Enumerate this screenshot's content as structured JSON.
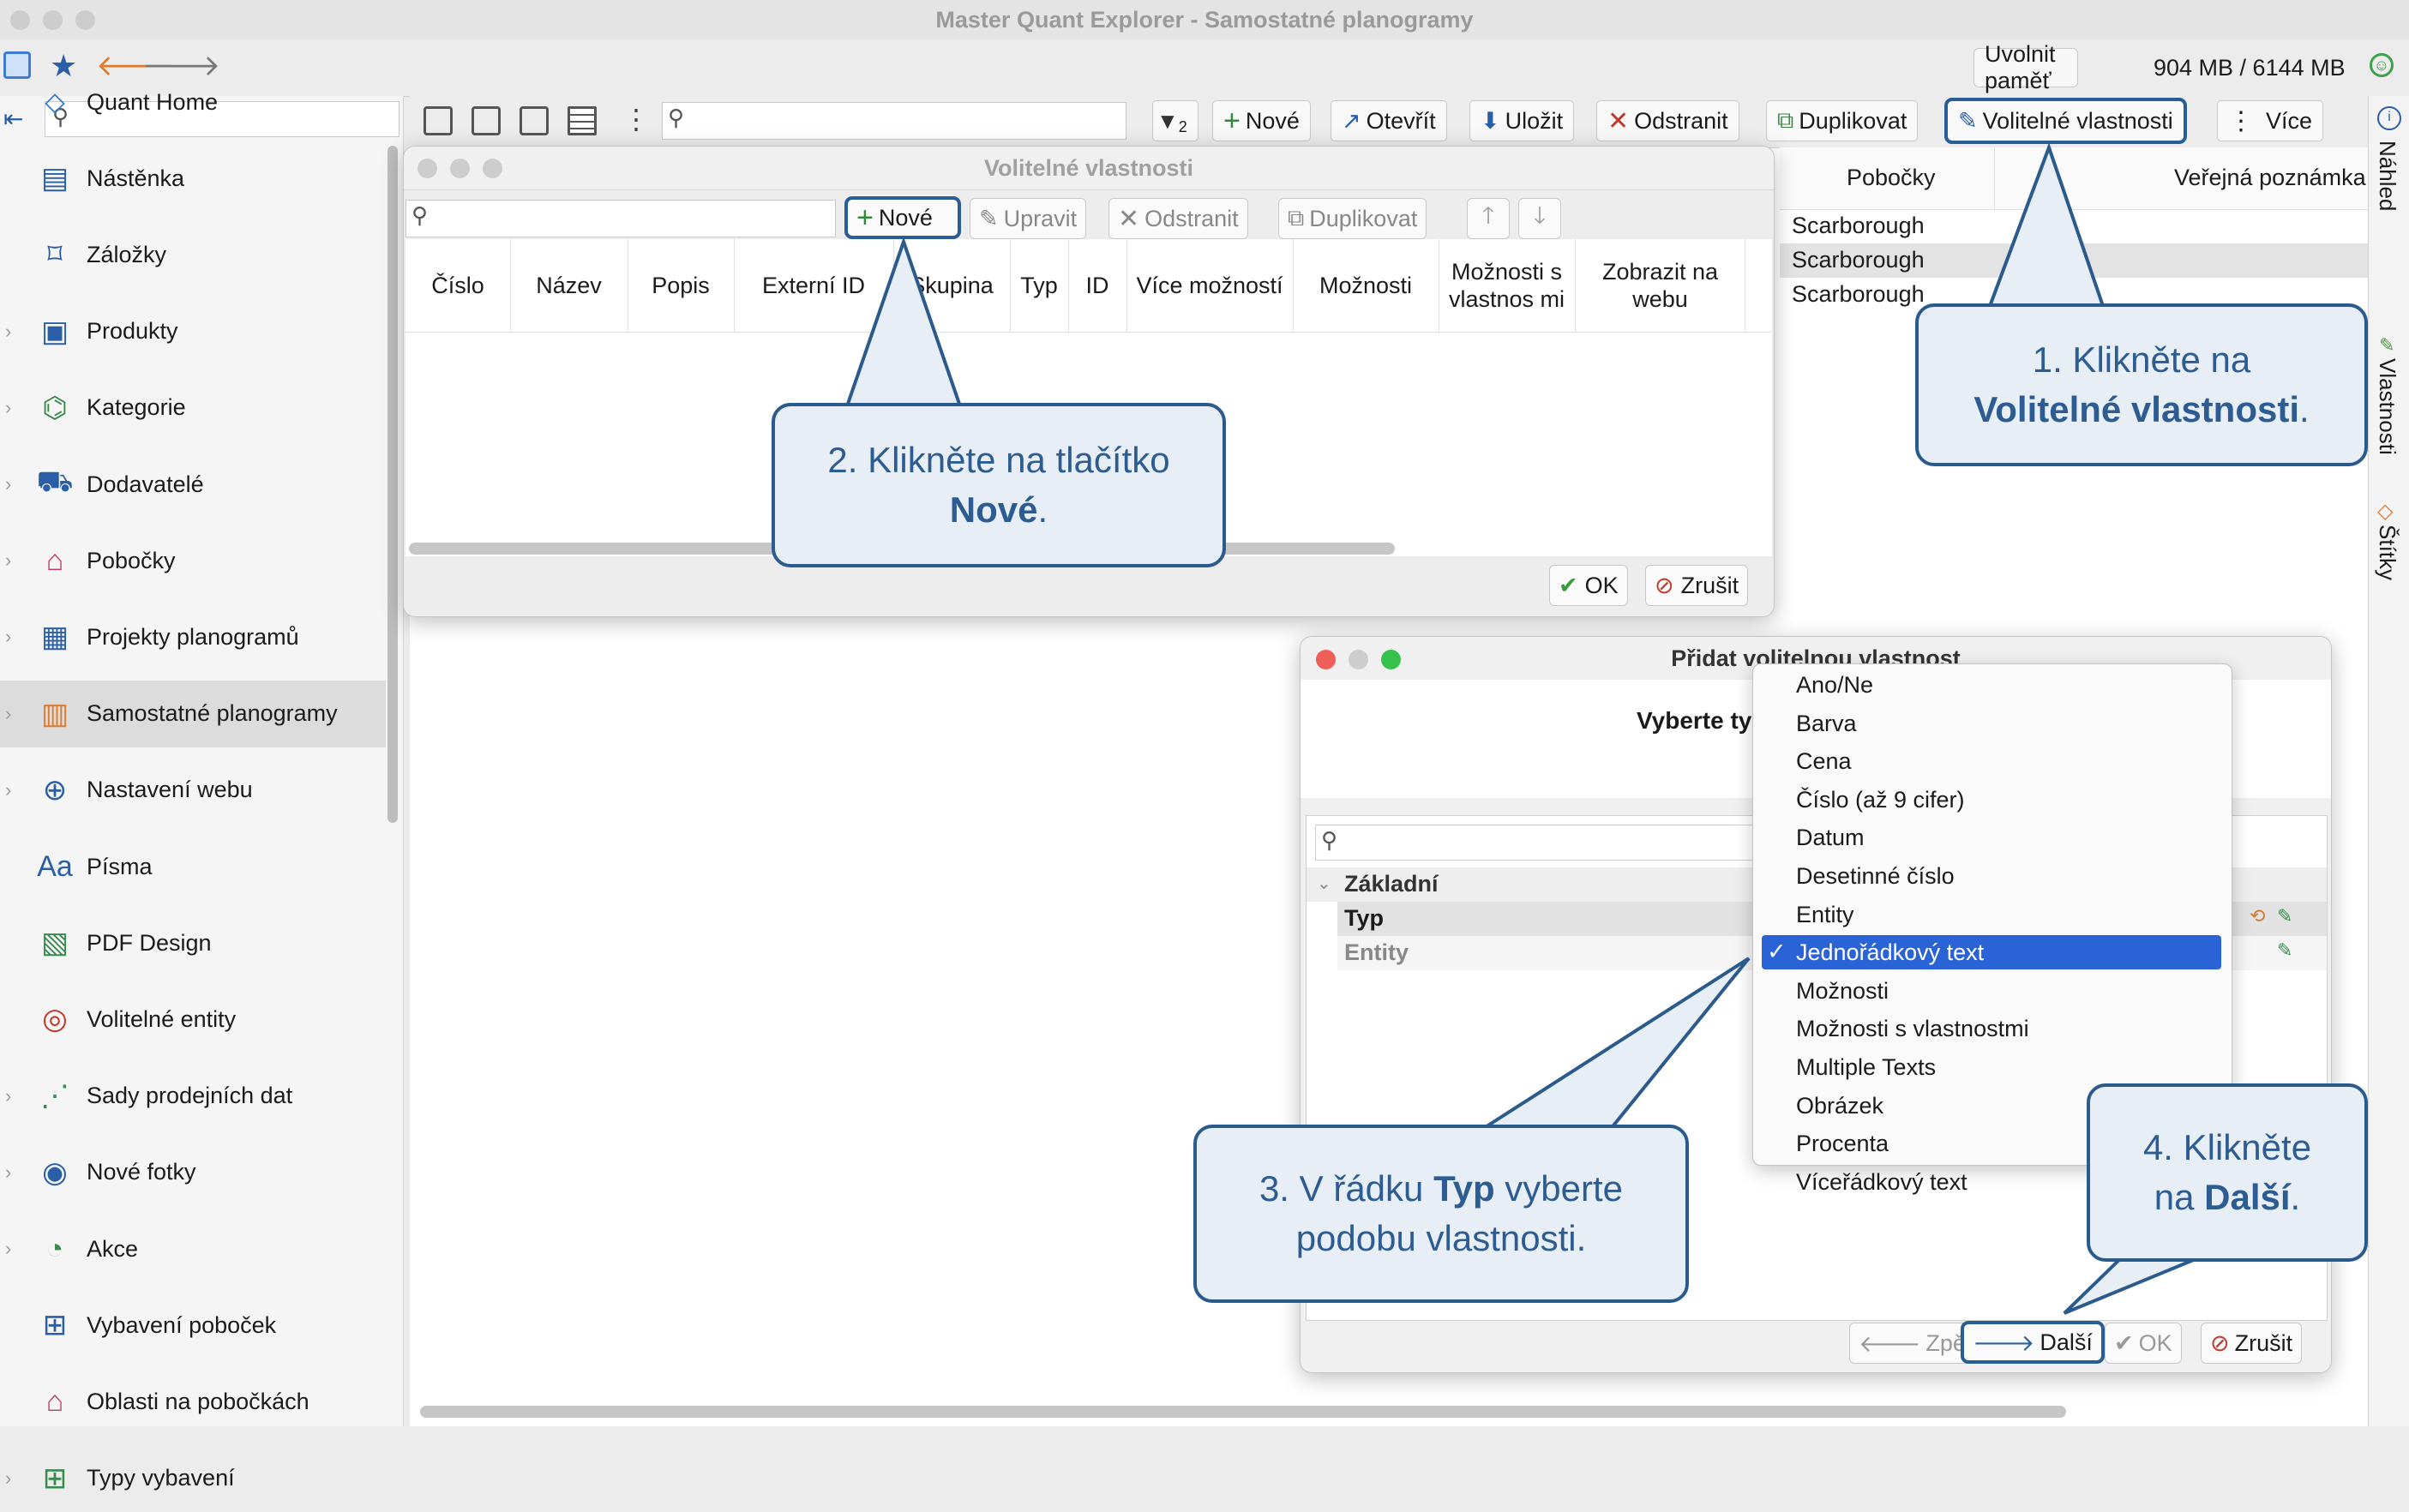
{
  "window": {
    "title": "Master Quant Explorer - Samostatné planogramy"
  },
  "topbar": {
    "free_memory": "Uvolnit paměť",
    "memory_usage": "904 MB / 6144 MB"
  },
  "sidebar": {
    "search_placeholder": "",
    "items": [
      {
        "label": "Quant Home",
        "icon": "quant-home-icon"
      },
      {
        "label": "Nástěnka",
        "icon": "dashboard-icon"
      },
      {
        "label": "Záložky",
        "icon": "bookmark-icon"
      },
      {
        "label": "Produkty",
        "icon": "products-icon"
      },
      {
        "label": "Kategorie",
        "icon": "categories-icon"
      },
      {
        "label": "Dodavatelé",
        "icon": "suppliers-icon"
      },
      {
        "label": "Pobočky",
        "icon": "stores-icon"
      },
      {
        "label": "Projekty planogramů",
        "icon": "planogram-projects-icon"
      },
      {
        "label": "Samostatné planogramy",
        "icon": "standalone-planograms-icon"
      },
      {
        "label": "Nastavení webu",
        "icon": "web-settings-icon"
      },
      {
        "label": "Písma",
        "icon": "fonts-icon"
      },
      {
        "label": "PDF Design",
        "icon": "pdf-design-icon"
      },
      {
        "label": "Volitelné entity",
        "icon": "optional-entities-icon"
      },
      {
        "label": "Sady prodejních dat",
        "icon": "sales-data-icon"
      },
      {
        "label": "Nové fotky",
        "icon": "camera-icon"
      },
      {
        "label": "Akce",
        "icon": "promotions-icon"
      },
      {
        "label": "Vybavení poboček",
        "icon": "store-equipment-icon"
      },
      {
        "label": "Oblasti na pobočkách",
        "icon": "store-areas-icon"
      },
      {
        "label": "Typy vybavení",
        "icon": "equipment-types-icon"
      }
    ]
  },
  "toolbar": {
    "filter_badge": "2",
    "new": "Nové",
    "open": "Otevřít",
    "save": "Uložit",
    "delete": "Odstranit",
    "duplicate": "Duplikovat",
    "optional_properties": "Volitelné vlastnosti",
    "more": "Více"
  },
  "table": {
    "columns": [
      "Pobočky",
      "Veřejná poznámka"
    ],
    "rows": [
      "Scarborough",
      "Scarborough",
      "Scarborough"
    ]
  },
  "right_tabs": [
    "Náhled",
    "Vlastnosti",
    "Štítky"
  ],
  "props_dialog": {
    "title": "Volitelné vlastnosti",
    "toolbar": {
      "new": "Nové",
      "edit": "Upravit",
      "delete": "Odstranit",
      "duplicate": "Duplikovat"
    },
    "columns": [
      "Číslo",
      "Název",
      "Popis",
      "Externí ID",
      "Skupina",
      "Typ",
      "ID",
      "Více možností",
      "Možnosti",
      "Možnosti s vlastnos mi",
      "Zobrazit na webu"
    ],
    "ok": "OK",
    "cancel": "Zrušit"
  },
  "add_dialog": {
    "title": "Přidat volitelnou vlastnost",
    "prompt": "Vyberte ty",
    "group": "Základní",
    "rows": [
      "Typ",
      "Entity"
    ],
    "back": "Zpět",
    "next": "Další",
    "ok": "OK",
    "cancel": "Zrušit"
  },
  "type_dropdown": {
    "options": [
      "Ano/Ne",
      "Barva",
      "Cena",
      "Číslo (až 9 cifer)",
      "Datum",
      "Desetinné číslo",
      "Entity",
      "Jednořádkový text",
      "Možnosti",
      "Možnosti s vlastnostmi",
      "Multiple Texts",
      "Obrázek",
      "Procenta",
      "Víceřádkový text"
    ],
    "selected": "Jednořádkový text",
    "check": "✓"
  },
  "callouts": {
    "c1": {
      "pre": "1. Klikněte na",
      "bold": "Volitelné vlastnosti",
      "post": "."
    },
    "c2": {
      "pre": "2. Klikněte na tlačítko",
      "bold": "Nové",
      "post": "."
    },
    "c3": {
      "pre": "3. V řádku",
      "bold": "Typ",
      "post": " vyberte",
      "line2": "podobu vlastnosti."
    },
    "c4": {
      "pre": "4. Klikněte",
      "line2pre": "na",
      "bold": "Další",
      "post": "."
    }
  },
  "colors": {
    "accent": "#2b5a8d",
    "callout_bg": "#e7eef6",
    "selection": "#2a63d6"
  }
}
